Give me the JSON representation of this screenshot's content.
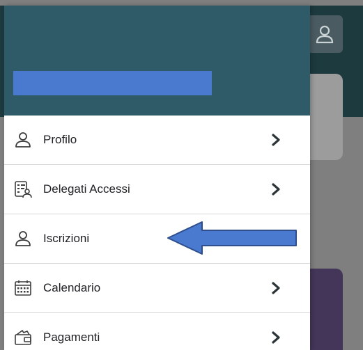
{
  "drawer": {
    "menu": [
      {
        "label": "Profilo",
        "icon": "person-icon"
      },
      {
        "label": "Delegati Accessi",
        "icon": "delegates-icon"
      },
      {
        "label": "Iscrizioni",
        "icon": "person-icon"
      },
      {
        "label": "Calendario",
        "icon": "calendar-icon"
      },
      {
        "label": "Pagamenti",
        "icon": "wallet-icon"
      }
    ]
  },
  "colors": {
    "drawer_header": "#2e5b67",
    "redaction_bar": "#4a79d0",
    "annotation_arrow": "#4a79d0",
    "background_header": "#1d3a3f",
    "background_purple_card": "#433659"
  }
}
